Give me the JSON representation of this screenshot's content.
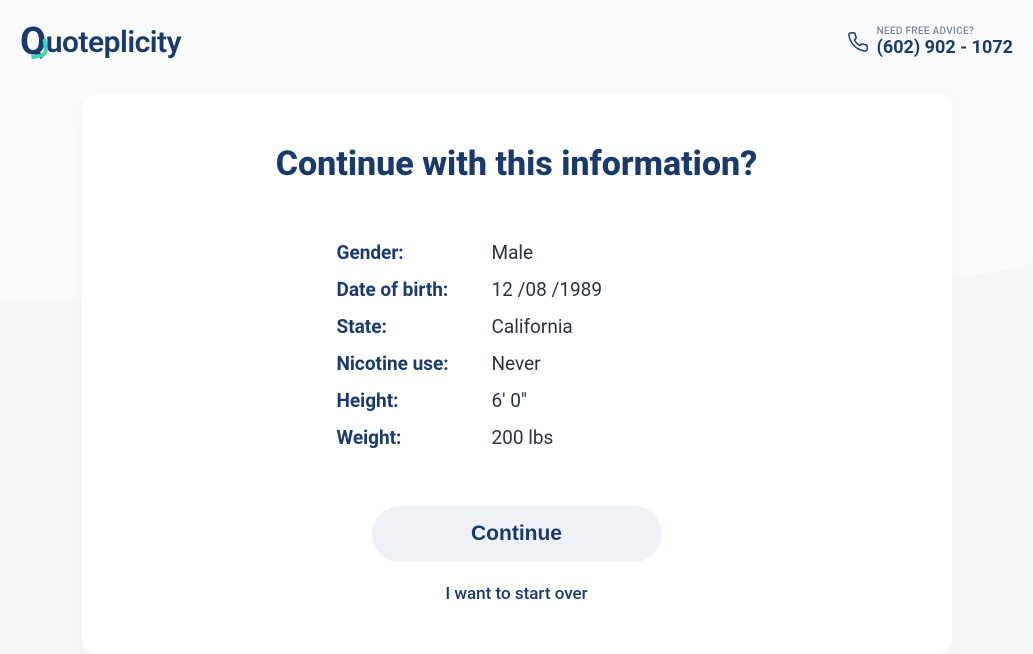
{
  "header": {
    "logo_text": "uoteplicity",
    "advice_label": "NEED FREE ADVICE?",
    "phone_number": "(602) 902 - 1072"
  },
  "card": {
    "title": "Continue with this information?",
    "info": [
      {
        "label": "Gender:",
        "value": "Male"
      },
      {
        "label": "Date of birth:",
        "value": "12 /08 /1989"
      },
      {
        "label": "State:",
        "value": "California"
      },
      {
        "label": "Nicotine use:",
        "value": "Never"
      },
      {
        "label": "Height:",
        "value": "6' 0\""
      },
      {
        "label": "Weight:",
        "value": "200 lbs"
      }
    ],
    "continue_label": "Continue",
    "start_over_label": "I want to start over"
  }
}
